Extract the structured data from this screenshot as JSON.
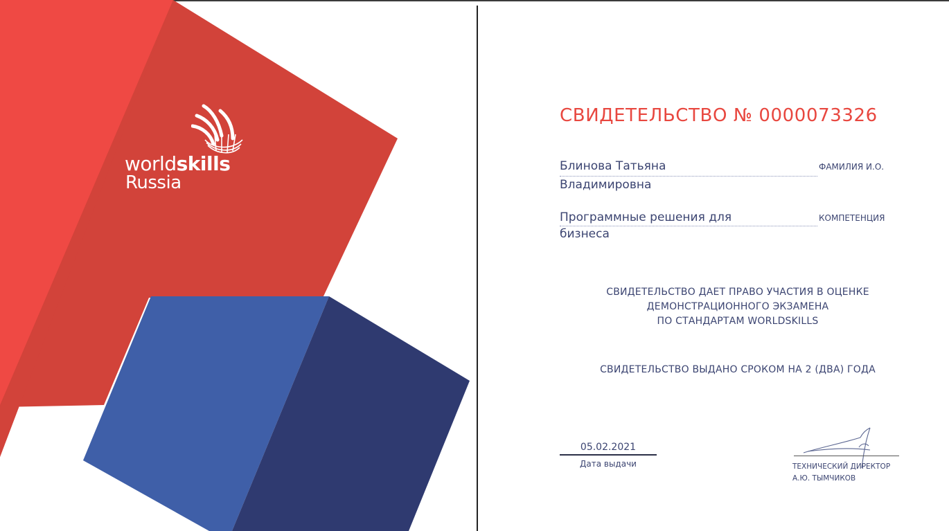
{
  "brand": {
    "line1_light": "world",
    "line1_bold": "skills",
    "line2": "Russia"
  },
  "colors": {
    "red_light": "#ef4944",
    "red_dark": "#d2433a",
    "blue_light": "#3f5fa8",
    "blue_dark": "#2f3a70",
    "text": "#3b4471",
    "title": "#e8473f"
  },
  "certificate": {
    "title": "СВИДЕТЕЛЬСТВО № 0000073326",
    "name_line1": "Блинова Татьяна",
    "name_line2": "Владимировна",
    "name_label": "ФАМИЛИЯ И.О.",
    "competence_line1": "Программные решения для",
    "competence_line2": "бизнеса",
    "competence_label": "КОМПЕТЕНЦИЯ",
    "notice_line1": "СВИДЕТЕЛЬСТВО ДАЕТ ПРАВО УЧАСТИЯ В ОЦЕНКЕ",
    "notice_line2": "ДЕМОНСТРАЦИОННОГО ЭКЗАМЕНА",
    "notice_line3": "ПО СТАНДАРТАМ WORLDSKILLS",
    "validity": "СВИДЕТЕЛЬСТВО ВЫДАНО СРОКОМ НА 2 (ДВА) ГОДА",
    "issue_date": "05.02.2021",
    "issue_date_label": "Дата выдачи",
    "signer_title": "ТЕХНИЧЕСКИЙ ДИРЕКТОР",
    "signer_name": "А.Ю. ТЫМЧИКОВ"
  }
}
